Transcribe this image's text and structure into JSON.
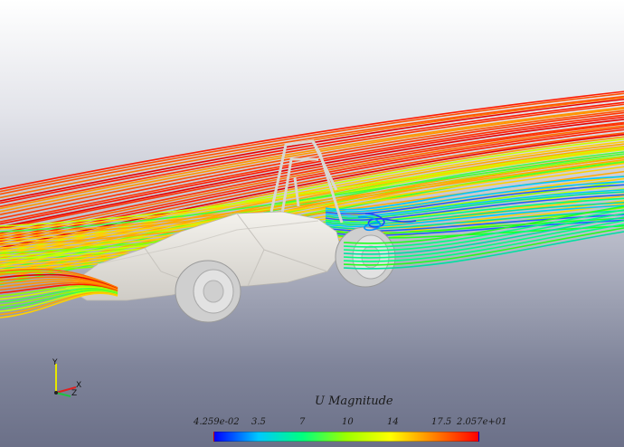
{
  "legend": {
    "title": "U Magnitude",
    "ticks": [
      "4.259e-02",
      "3.5",
      "7",
      "10",
      "14",
      "17.5",
      "2.057e+01"
    ],
    "range": [
      0.04259,
      20.57
    ],
    "colormap": [
      "#0000ff",
      "#00c8ff",
      "#00ff80",
      "#9cff00",
      "#ffff00",
      "#ff8000",
      "#ff0000"
    ]
  },
  "orientation_axes": {
    "y_label": "Y",
    "x_label": "X",
    "z_label": "Z"
  },
  "colors": {
    "background_top": "#ffffff",
    "background_bottom": "#6b7088",
    "car_body": "#e9e7e2",
    "tire": "#d3d3d3"
  }
}
